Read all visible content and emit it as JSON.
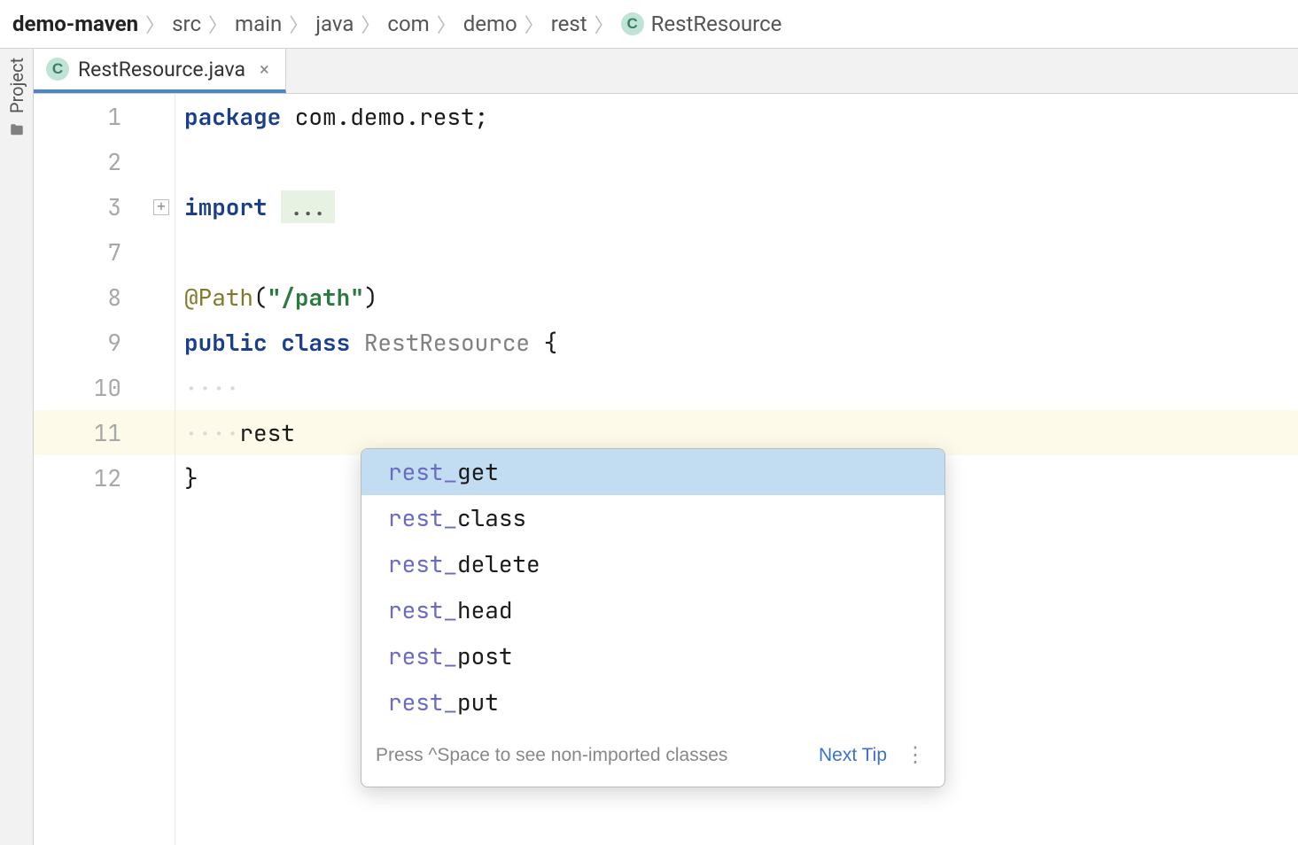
{
  "breadcrumb": {
    "items": [
      {
        "label": "demo-maven",
        "bold": true
      },
      {
        "label": "src"
      },
      {
        "label": "main"
      },
      {
        "label": "java"
      },
      {
        "label": "com"
      },
      {
        "label": "demo"
      },
      {
        "label": "rest"
      },
      {
        "label": "RestResource",
        "icon": "class"
      }
    ]
  },
  "sideTool": {
    "label": "Project"
  },
  "tab": {
    "label": "RestResource.java",
    "icon_letter": "C"
  },
  "editor": {
    "lines": [
      {
        "n": "1",
        "tokens": [
          {
            "t": "package",
            "c": "kw"
          },
          {
            "t": " com.demo.rest;",
            "c": "plain"
          }
        ]
      },
      {
        "n": "2",
        "tokens": []
      },
      {
        "n": "3",
        "fold": true,
        "tokens": [
          {
            "t": "import ",
            "c": "kw"
          },
          {
            "t": "...",
            "c": "fold-box"
          }
        ]
      },
      {
        "n": "7",
        "tokens": []
      },
      {
        "n": "8",
        "tokens": [
          {
            "t": "@Path",
            "c": "ann"
          },
          {
            "t": "(",
            "c": "plain"
          },
          {
            "t": "\"/path\"",
            "c": "str bold"
          },
          {
            "t": ")",
            "c": "plain"
          }
        ]
      },
      {
        "n": "9",
        "tokens": [
          {
            "t": "public class ",
            "c": "kw"
          },
          {
            "t": "RestResource ",
            "c": "dim"
          },
          {
            "t": "{",
            "c": "plain"
          }
        ]
      },
      {
        "n": "10",
        "tokens": [
          {
            "t": "····",
            "c": "whitespace"
          }
        ]
      },
      {
        "n": "11",
        "current": true,
        "tokens": [
          {
            "t": "····",
            "c": "whitespace"
          },
          {
            "t": "rest",
            "c": "plain"
          }
        ]
      },
      {
        "n": "12",
        "tokens": [
          {
            "t": "}",
            "c": "plain"
          }
        ]
      }
    ]
  },
  "completion": {
    "items": [
      {
        "prefix": "rest_",
        "suffix": "get",
        "selected": true
      },
      {
        "prefix": "rest_",
        "suffix": "class"
      },
      {
        "prefix": "rest_",
        "suffix": "delete"
      },
      {
        "prefix": "rest_",
        "suffix": "head"
      },
      {
        "prefix": "rest_",
        "suffix": "post"
      },
      {
        "prefix": "rest_",
        "suffix": "put"
      }
    ],
    "footer_tip": "Press ^Space to see non-imported classes",
    "next_tip": "Next Tip"
  }
}
